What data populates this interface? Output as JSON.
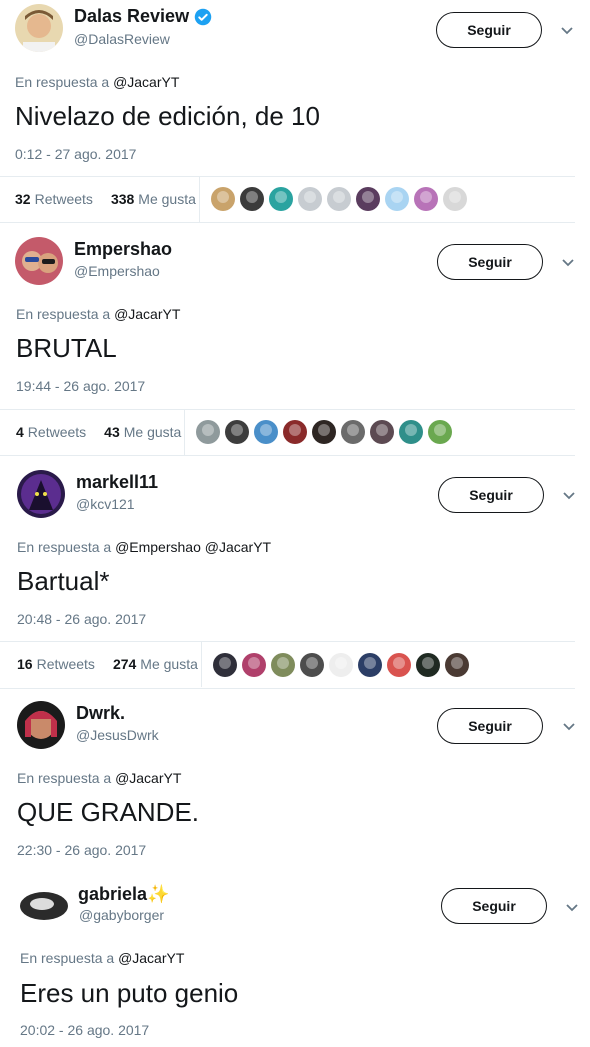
{
  "colors": {
    "accent": "#1da1f2",
    "text": "#14171a",
    "muted": "#657786",
    "divider": "#e6ecf0"
  },
  "tweets": [
    {
      "name": "Dalas Review",
      "handle": "@DalasReview",
      "verified": true,
      "follow_label": "Seguir",
      "reply_prefix": "En respuesta a",
      "reply_mentions": "@JacarYT",
      "text": "Nivelazo de edición, de 10",
      "time": "0:12 - 27 ago. 2017",
      "retweets_count": "32",
      "retweets_label": "Retweets",
      "likes_count": "338",
      "likes_label": "Me gusta",
      "likers": [
        "#c9a36b",
        "#3b3b3b",
        "#2aa3a0",
        "#c7ccd1",
        "#c7ccd1",
        "#5a3c5e",
        "#a9d4f2",
        "#b873b8",
        "#d8d8d8"
      ]
    },
    {
      "name": "Empershao",
      "handle": "@Empershao",
      "verified": false,
      "follow_label": "Seguir",
      "reply_prefix": "En respuesta a",
      "reply_mentions": "@JacarYT",
      "text": "BRUTAL",
      "time": "19:44 - 26 ago. 2017",
      "retweets_count": "4",
      "retweets_label": "Retweets",
      "likes_count": "43",
      "likes_label": "Me gusta",
      "likers": [
        "#8f9a9c",
        "#3d3d3d",
        "#4a8fc9",
        "#8a2a2a",
        "#2e2623",
        "#6b6b6b",
        "#5c4a52",
        "#2f8f8a",
        "#6aa84f"
      ]
    },
    {
      "name": "markell11",
      "handle": "@kcv121",
      "verified": false,
      "follow_label": "Seguir",
      "reply_prefix": "En respuesta a",
      "reply_mentions": "@Empershao @JacarYT",
      "text": "Bartual*",
      "time": "20:48 - 26 ago. 2017",
      "retweets_count": "16",
      "retweets_label": "Retweets",
      "likes_count": "274",
      "likes_label": "Me gusta",
      "likers": [
        "#2f2f3a",
        "#b0406b",
        "#7f8c5c",
        "#4d4d4d",
        "#eeeeee",
        "#2c3e66",
        "#d9534f",
        "#1f2a22",
        "#4a3a33"
      ]
    },
    {
      "name": "Dwrk.",
      "handle": "@JesusDwrk",
      "verified": false,
      "follow_label": "Seguir",
      "reply_prefix": "En respuesta a",
      "reply_mentions": "@JacarYT",
      "text": "QUE GRANDE.",
      "time": "22:30 - 26 ago. 2017"
    },
    {
      "name": "gabriela✨",
      "handle": "@gabyborger",
      "verified": false,
      "follow_label": "Seguir",
      "reply_prefix": "En respuesta a",
      "reply_mentions": "@JacarYT",
      "text": "Eres un puto genio",
      "time": "20:02 - 26 ago. 2017"
    }
  ]
}
